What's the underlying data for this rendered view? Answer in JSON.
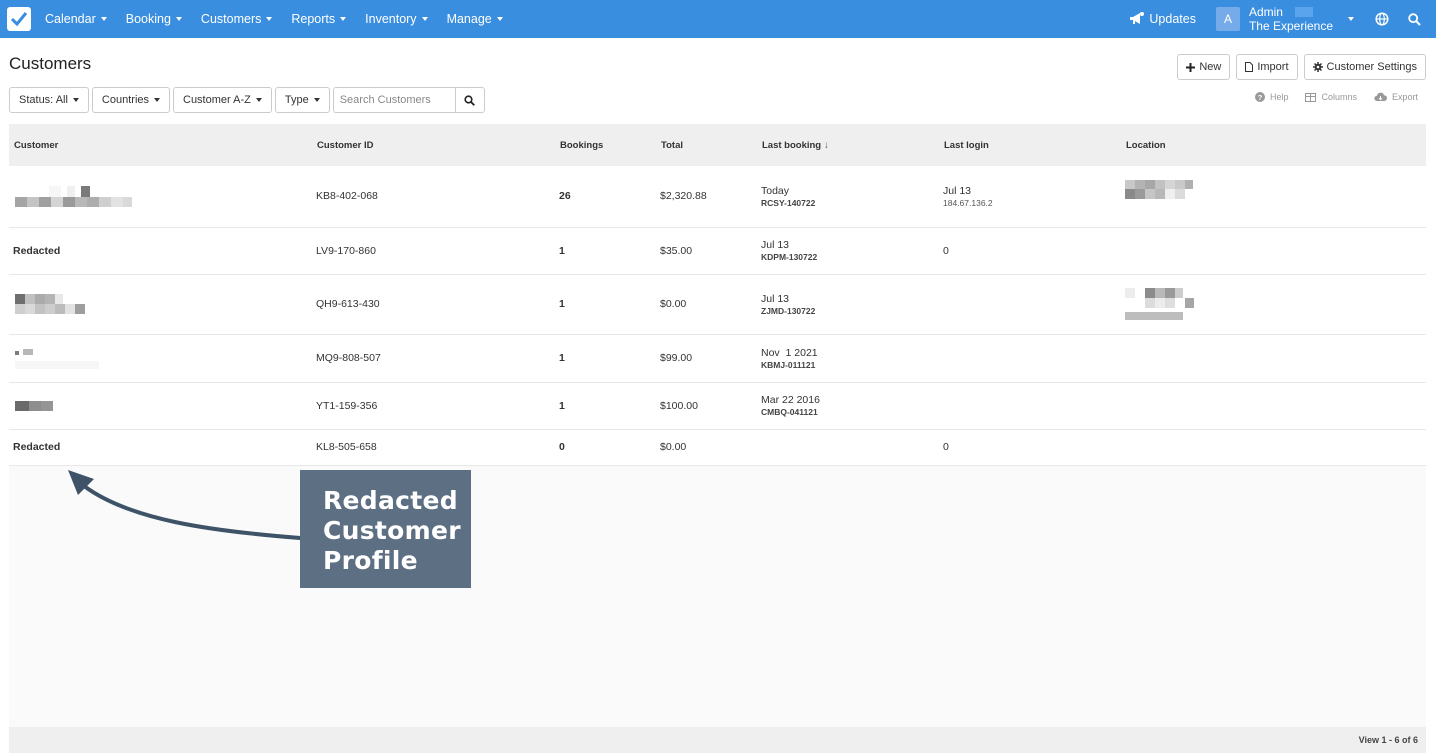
{
  "nav": {
    "items": [
      "Calendar",
      "Booking",
      "Customers",
      "Reports",
      "Inventory",
      "Manage"
    ],
    "updates": "Updates",
    "avatar_letter": "A",
    "admin_name": "Admin",
    "org_name": "The Experience"
  },
  "page": {
    "title": "Customers",
    "actions": {
      "new": "New",
      "import": "Import",
      "settings": "Customer Settings"
    }
  },
  "filters": {
    "status": "Status: All",
    "countries": "Countries",
    "sort": "Customer A-Z",
    "type": "Type",
    "search_placeholder": "Search Customers"
  },
  "tools": {
    "help": "Help",
    "columns": "Columns",
    "export": "Export"
  },
  "table": {
    "headers": {
      "customer": "Customer",
      "customer_id": "Customer ID",
      "bookings": "Bookings",
      "total": "Total",
      "last_booking": "Last booking",
      "sort_indicator": "↓",
      "last_login": "Last login",
      "location": "Location"
    },
    "rows": [
      {
        "customer": "",
        "id": "KB8-402-068",
        "bookings": "26",
        "total": "$2,320.88",
        "last_booking": "Today",
        "booking_ref": "RCSY-140722",
        "last_login": "Jul 13",
        "login_ip": "184.67.136.2"
      },
      {
        "customer": "Redacted",
        "id": "LV9-170-860",
        "bookings": "1",
        "total": "$35.00",
        "last_booking": "Jul 13",
        "booking_ref": "KDPM-130722",
        "last_login": "0",
        "login_ip": ""
      },
      {
        "customer": "",
        "id": "QH9-613-430",
        "bookings": "1",
        "total": "$0.00",
        "last_booking": "Jul 13",
        "booking_ref": "ZJMD-130722",
        "last_login": "",
        "login_ip": ""
      },
      {
        "customer": "",
        "id": "MQ9-808-507",
        "bookings": "1",
        "total": "$99.00",
        "last_booking": "Nov  1 2021",
        "booking_ref": "KBMJ-011121",
        "last_login": "",
        "login_ip": ""
      },
      {
        "customer": "",
        "id": "YT1-159-356",
        "bookings": "1",
        "total": "$100.00",
        "last_booking": "Mar 22 2016",
        "booking_ref": "CMBQ-041121",
        "last_login": "",
        "login_ip": ""
      },
      {
        "customer": "Redacted",
        "id": "KL8-505-658",
        "bookings": "0",
        "total": "$0.00",
        "last_booking": "",
        "booking_ref": "",
        "last_login": "0",
        "login_ip": ""
      }
    ]
  },
  "footer": {
    "pagination": "View 1 - 6 of 6"
  },
  "annotation": {
    "line1": "Redacted",
    "line2": "Customer",
    "line3": "Profile"
  },
  "colors": {
    "topbar": "#3a8ee0",
    "callout": "#5d6f82",
    "arrow": "#3f5368"
  }
}
